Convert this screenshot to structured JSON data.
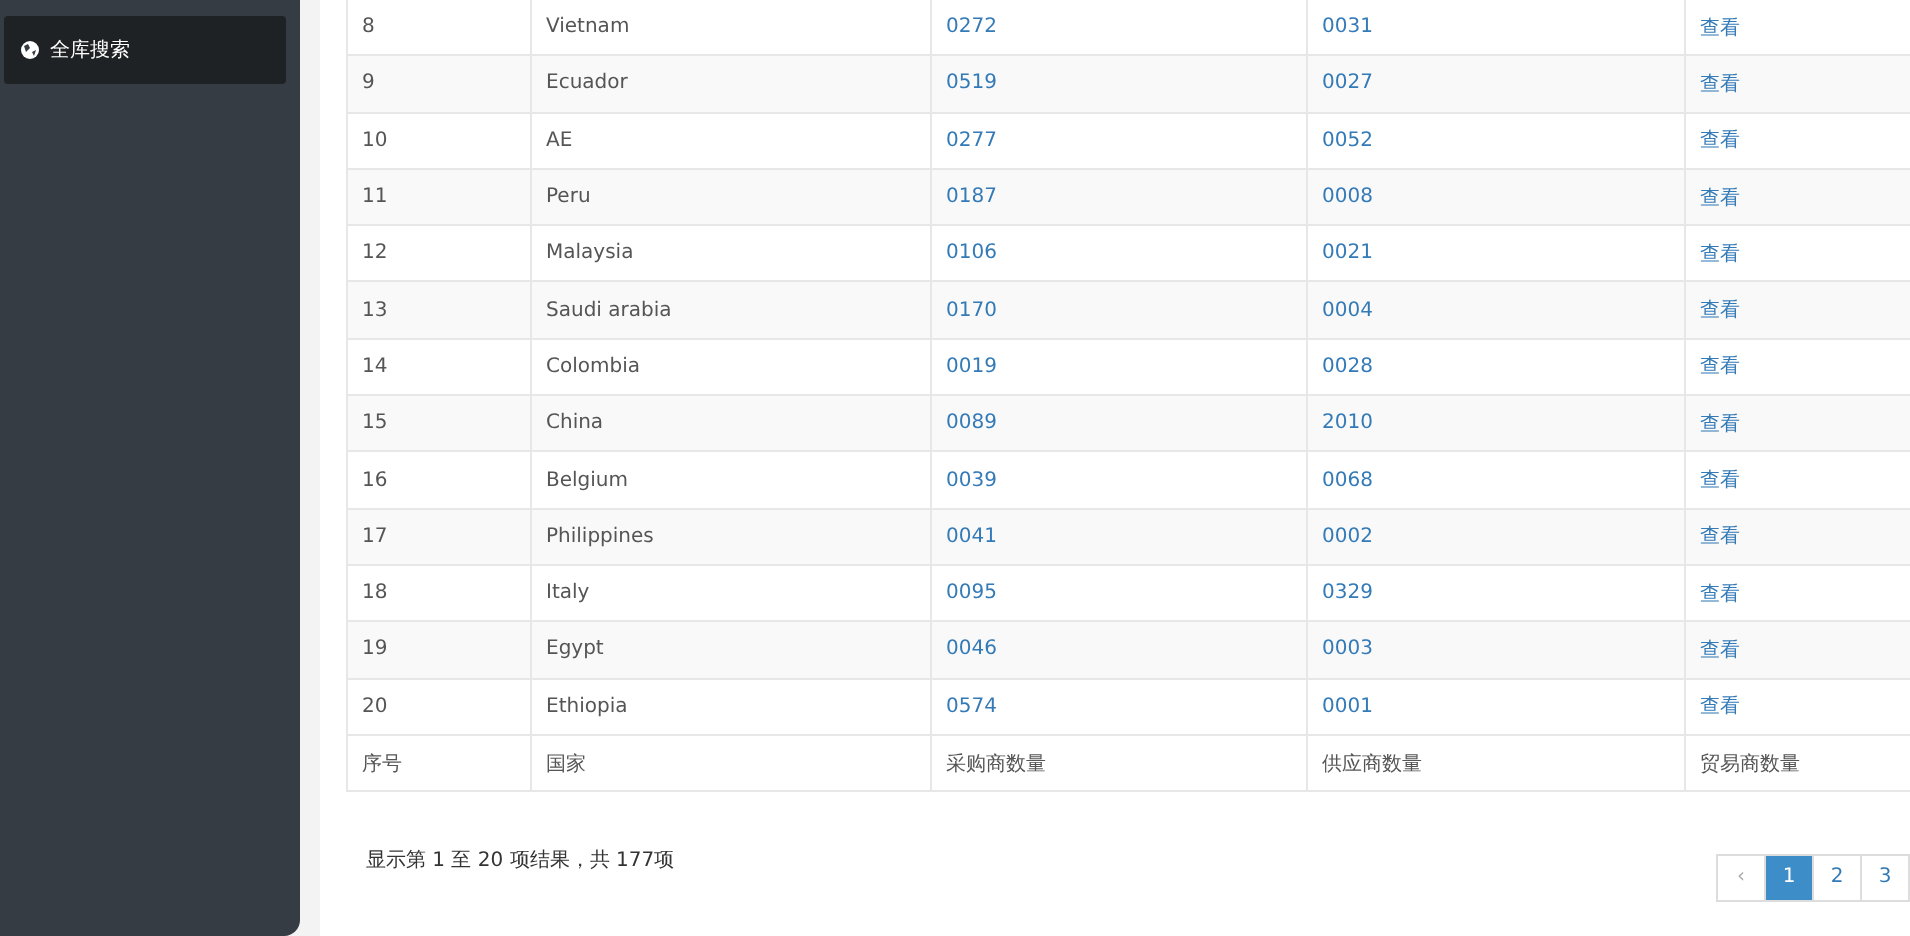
{
  "sidebar": {
    "items": [
      {
        "label": "全库搜索",
        "selected": true
      }
    ]
  },
  "table": {
    "rows": [
      [
        "8",
        "Vietnam",
        "0272",
        "0031",
        "查看"
      ],
      [
        "9",
        "Ecuador",
        "0519",
        "0027",
        "查看"
      ],
      [
        "10",
        "AE",
        "0277",
        "0052",
        "查看"
      ],
      [
        "11",
        "Peru",
        "0187",
        "0008",
        "查看"
      ],
      [
        "12",
        "Malaysia",
        "0106",
        "0021",
        "查看"
      ],
      [
        "13",
        "Saudi arabia",
        "0170",
        "0004",
        "查看"
      ],
      [
        "14",
        "Colombia",
        "0019",
        "0028",
        "查看"
      ],
      [
        "15",
        "China",
        "0089",
        "2010",
        "查看"
      ],
      [
        "16",
        "Belgium",
        "0039",
        "0068",
        "查看"
      ],
      [
        "17",
        "Philippines",
        "0041",
        "0002",
        "查看"
      ],
      [
        "18",
        "Italy",
        "0095",
        "0329",
        "查看"
      ],
      [
        "19",
        "Egypt",
        "0046",
        "0003",
        "查看"
      ],
      [
        "20",
        "Ethiopia",
        "0574",
        "0001",
        "查看"
      ]
    ],
    "footer_columns": [
      "序号",
      "国家",
      "采购商数量",
      "供应商数量",
      "贸易商数量"
    ]
  },
  "info": "显示第 1 至 20 项结果，共 177项",
  "pagination": [
    {
      "label": "‹",
      "selected": false,
      "disabled": true
    },
    {
      "label": "1",
      "selected": true,
      "disabled": false
    },
    {
      "label": "2",
      "selected": false,
      "disabled": false
    },
    {
      "label": "3",
      "selected": false,
      "disabled": false
    }
  ]
}
